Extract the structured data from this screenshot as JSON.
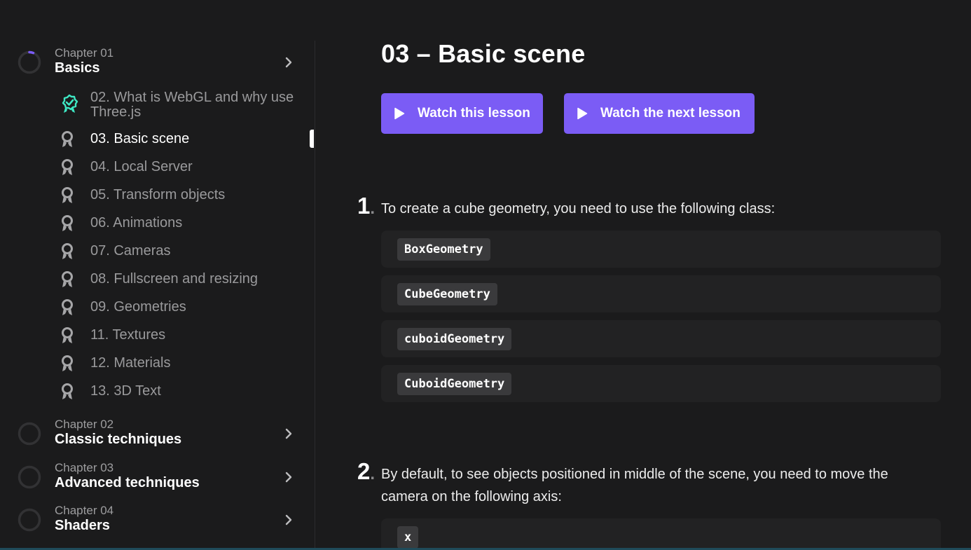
{
  "colors": {
    "background": "#1b1b1c",
    "accent": "#7b5cf5",
    "done_icon": "#3ee8c4",
    "muted_text": "#9a9a9c",
    "option_bg": "#222223",
    "code_chip_bg": "#3a3a3c"
  },
  "sidebar": {
    "chapters": [
      {
        "number": "Chapter 01",
        "title": "Basics",
        "progress": 0.06,
        "expanded": true
      },
      {
        "number": "Chapter 02",
        "title": "Classic techniques",
        "progress": 0
      },
      {
        "number": "Chapter 03",
        "title": "Advanced techniques",
        "progress": 0
      },
      {
        "number": "Chapter 04",
        "title": "Shaders",
        "progress": 0
      }
    ],
    "lessons": [
      {
        "label": "02. What is WebGL and why use Three.js",
        "state": "completed"
      },
      {
        "label": "03. Basic scene",
        "state": "current"
      },
      {
        "label": "04. Local Server",
        "state": "pending"
      },
      {
        "label": "05. Transform objects",
        "state": "pending"
      },
      {
        "label": "06. Animations",
        "state": "pending"
      },
      {
        "label": "07. Cameras",
        "state": "pending"
      },
      {
        "label": "08. Fullscreen and resizing",
        "state": "pending"
      },
      {
        "label": "09. Geometries",
        "state": "pending"
      },
      {
        "label": "11. Textures",
        "state": "pending"
      },
      {
        "label": "12. Materials",
        "state": "pending"
      },
      {
        "label": "13. 3D Text",
        "state": "pending"
      }
    ]
  },
  "main": {
    "title": "03 – Basic scene",
    "watch_this_label": "Watch this lesson",
    "watch_next_label": "Watch the next lesson",
    "questions": [
      {
        "number": "1",
        "text": "To create a cube geometry, you need to use the following class:",
        "options": [
          "BoxGeometry",
          "CubeGeometry",
          "cuboidGeometry",
          "CuboidGeometry"
        ]
      },
      {
        "number": "2",
        "text": "By default, to see objects positioned in middle of the scene, you need to move the camera on the following axis:",
        "options": [
          "x"
        ]
      }
    ]
  },
  "icons": {
    "chapter_progress": "progress-ring-icon",
    "chapter_expand": "chevron-right-icon",
    "lesson_pending": "award-ribbon-icon",
    "lesson_completed": "award-check-icon",
    "button_play": "play-icon"
  }
}
